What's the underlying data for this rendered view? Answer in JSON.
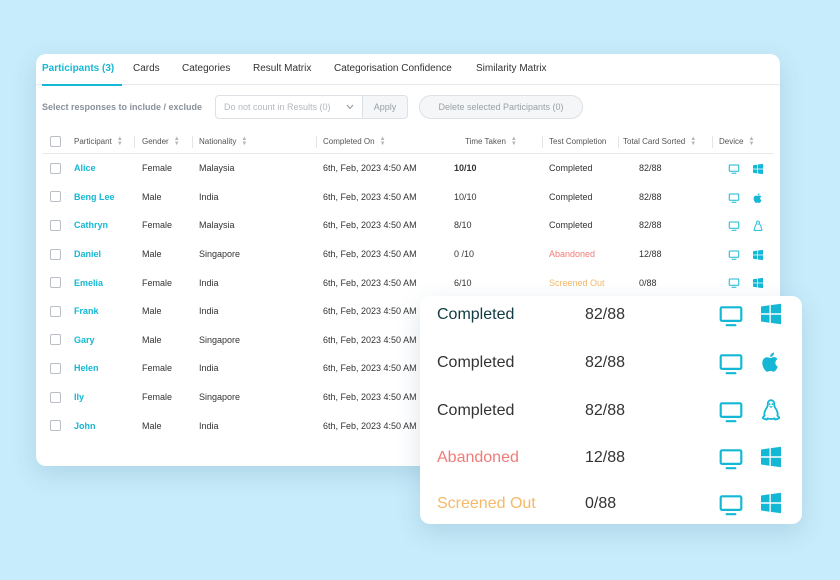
{
  "tabs": [
    {
      "label": "Participants (3)",
      "active": true
    },
    {
      "label": "Cards",
      "active": false
    },
    {
      "label": "Categories",
      "active": false
    },
    {
      "label": "Result Matrix",
      "active": false
    },
    {
      "label": "Categorisation Confidence",
      "active": false
    },
    {
      "label": "Similarity Matrix",
      "active": false
    }
  ],
  "toolbar": {
    "label": "Select responses to include / exclude",
    "select_value": "Do not count in Results (0)",
    "apply_label": "Apply",
    "delete_label": "Delete selected Participants (0)"
  },
  "table": {
    "headers": {
      "participant": "Participant",
      "gender": "Gender",
      "nationality": "Nationality",
      "completed_on": "Completed On",
      "time_taken": "Time Taken",
      "test_completion": "Test Completion",
      "total_card_sorted": "Total Card Sorted",
      "device": "Device"
    },
    "rows": [
      {
        "name": "Alice",
        "gender": "Female",
        "nationality": "Malaysia",
        "completed_on": "6th, Feb, 2023 4:50 AM",
        "time_taken": "10/10",
        "status": "Completed",
        "status_type": "completed",
        "total": "82/88",
        "device": "desktop-icon",
        "os": "windows-icon"
      },
      {
        "name": "Beng Lee",
        "gender": "Male",
        "nationality": "India",
        "completed_on": "6th, Feb, 2023 4:50 AM",
        "time_taken": "10/10",
        "status": "Completed",
        "status_type": "completed",
        "total": "82/88",
        "device": "desktop-icon",
        "os": "apple-icon"
      },
      {
        "name": "Cathryn",
        "gender": "Female",
        "nationality": "Malaysia",
        "completed_on": "6th, Feb, 2023 4:50 AM",
        "time_taken": "8/10",
        "status": "Completed",
        "status_type": "completed",
        "total": "82/88",
        "device": "desktop-icon",
        "os": "linux-icon"
      },
      {
        "name": "Daniel",
        "gender": "Male",
        "nationality": "Singapore",
        "completed_on": "6th, Feb, 2023 4:50 AM",
        "time_taken": "0 /10",
        "status": "Abandoned",
        "status_type": "abandoned",
        "total": "12/88",
        "device": "desktop-icon",
        "os": "windows-icon"
      },
      {
        "name": "Emelia",
        "gender": "Female",
        "nationality": "India",
        "completed_on": "6th, Feb, 2023 4:50 AM",
        "time_taken": "6/10",
        "status": "Screened Out",
        "status_type": "screened",
        "total": "0/88",
        "device": "desktop-icon",
        "os": "windows-icon"
      },
      {
        "name": "Frank",
        "gender": "Male",
        "nationality": "India",
        "completed_on": "6th, Feb, 2023 4:50 AM"
      },
      {
        "name": "Gary",
        "gender": "Male",
        "nationality": "Singapore",
        "completed_on": "6th, Feb, 2023 4:50 AM"
      },
      {
        "name": "Helen",
        "gender": "Female",
        "nationality": "India",
        "completed_on": "6th, Feb, 2023 4:50 AM"
      },
      {
        "name": "Ily",
        "gender": "Female",
        "nationality": "Singapore",
        "completed_on": "6th, Feb, 2023 4:50 AM"
      },
      {
        "name": "John",
        "gender": "Male",
        "nationality": "India",
        "completed_on": "6th, Feb, 2023 4:50 AM"
      }
    ]
  },
  "zoom": {
    "rows": [
      {
        "status": "Completed",
        "status_type": "completed",
        "total": "82/88",
        "os": "windows-icon"
      },
      {
        "status": "Completed",
        "status_type": "completed",
        "total": "82/88",
        "os": "apple-icon"
      },
      {
        "status": "Completed",
        "status_type": "completed",
        "total": "82/88",
        "os": "linux-icon"
      },
      {
        "status": "Abandoned",
        "status_type": "abandoned",
        "total": "12/88",
        "os": "windows-icon"
      },
      {
        "status": "Screened Out",
        "status_type": "screened",
        "total": "0/88",
        "os": "windows-icon"
      }
    ]
  },
  "colors": {
    "accent": "#14b8d4",
    "completed": "#333333",
    "completed_dark": "#0f3b42",
    "abandoned": "#f07b78",
    "screened": "#f5b969",
    "background": "#c7ecfb"
  }
}
